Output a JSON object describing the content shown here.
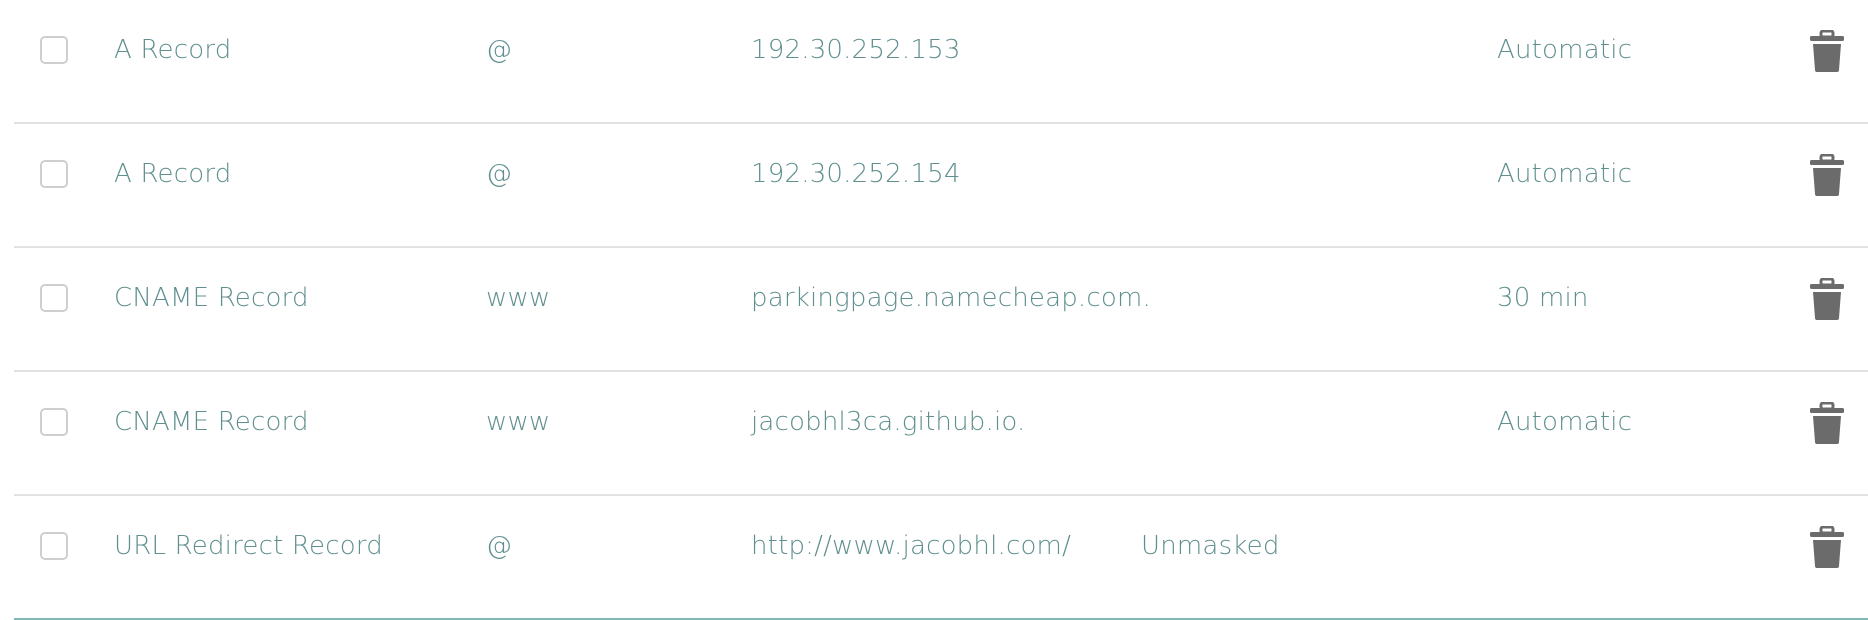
{
  "records": [
    {
      "type": "A Record",
      "host": "@",
      "value": "192.30.252.153",
      "extra": "",
      "ttl": "Automatic"
    },
    {
      "type": "A Record",
      "host": "@",
      "value": "192.30.252.154",
      "extra": "",
      "ttl": "Automatic"
    },
    {
      "type": "CNAME Record",
      "host": "www",
      "value": "parkingpage.namecheap.com.",
      "extra": "",
      "ttl": "30 min"
    },
    {
      "type": "CNAME Record",
      "host": "www",
      "value": "jacobhl3ca.github.io.",
      "extra": "",
      "ttl": "Automatic"
    },
    {
      "type": "URL Redirect Record",
      "host": "@",
      "value": "http://www.jacobhl.com/",
      "extra": "Unmasked",
      "ttl": ""
    }
  ],
  "colors": {
    "text": "#5f8f8e",
    "icon": "#6b6b6b",
    "divider": "#e2e2e2",
    "accent_divider": "#7fb8b5"
  },
  "icons": {
    "delete": "trash-icon",
    "select": "checkbox"
  }
}
